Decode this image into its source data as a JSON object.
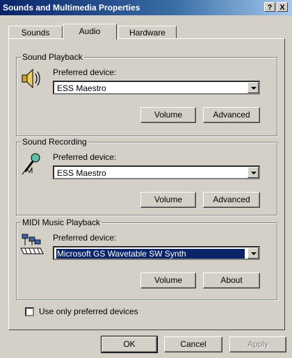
{
  "window": {
    "title": "Sounds and Multimedia Properties",
    "help_glyph": "?",
    "close_glyph": "X"
  },
  "tabs": [
    {
      "label": "Sounds",
      "active": false
    },
    {
      "label": "Audio",
      "active": true
    },
    {
      "label": "Hardware",
      "active": false
    }
  ],
  "sound_playback": {
    "group_label": "Sound Playback",
    "preferred_label": "Preferred device:",
    "device": "ESS Maestro",
    "volume": "Volume",
    "advanced": "Advanced",
    "icon": "speaker-icon"
  },
  "sound_recording": {
    "group_label": "Sound Recording",
    "preferred_label": "Preferred device:",
    "device": "ESS Maestro",
    "volume": "Volume",
    "advanced": "Advanced",
    "icon": "microphone-icon"
  },
  "midi_playback": {
    "group_label": "MIDI Music Playback",
    "preferred_label": "Preferred device:",
    "device": "Microsoft GS Wavetable SW Synth",
    "volume": "Volume",
    "about": "About",
    "icon": "midi-keyboard-icon"
  },
  "options": {
    "preferred_only_label": "Use only preferred devices",
    "preferred_only_checked": false
  },
  "footer": {
    "ok": "OK",
    "cancel": "Cancel",
    "apply": "Apply"
  }
}
